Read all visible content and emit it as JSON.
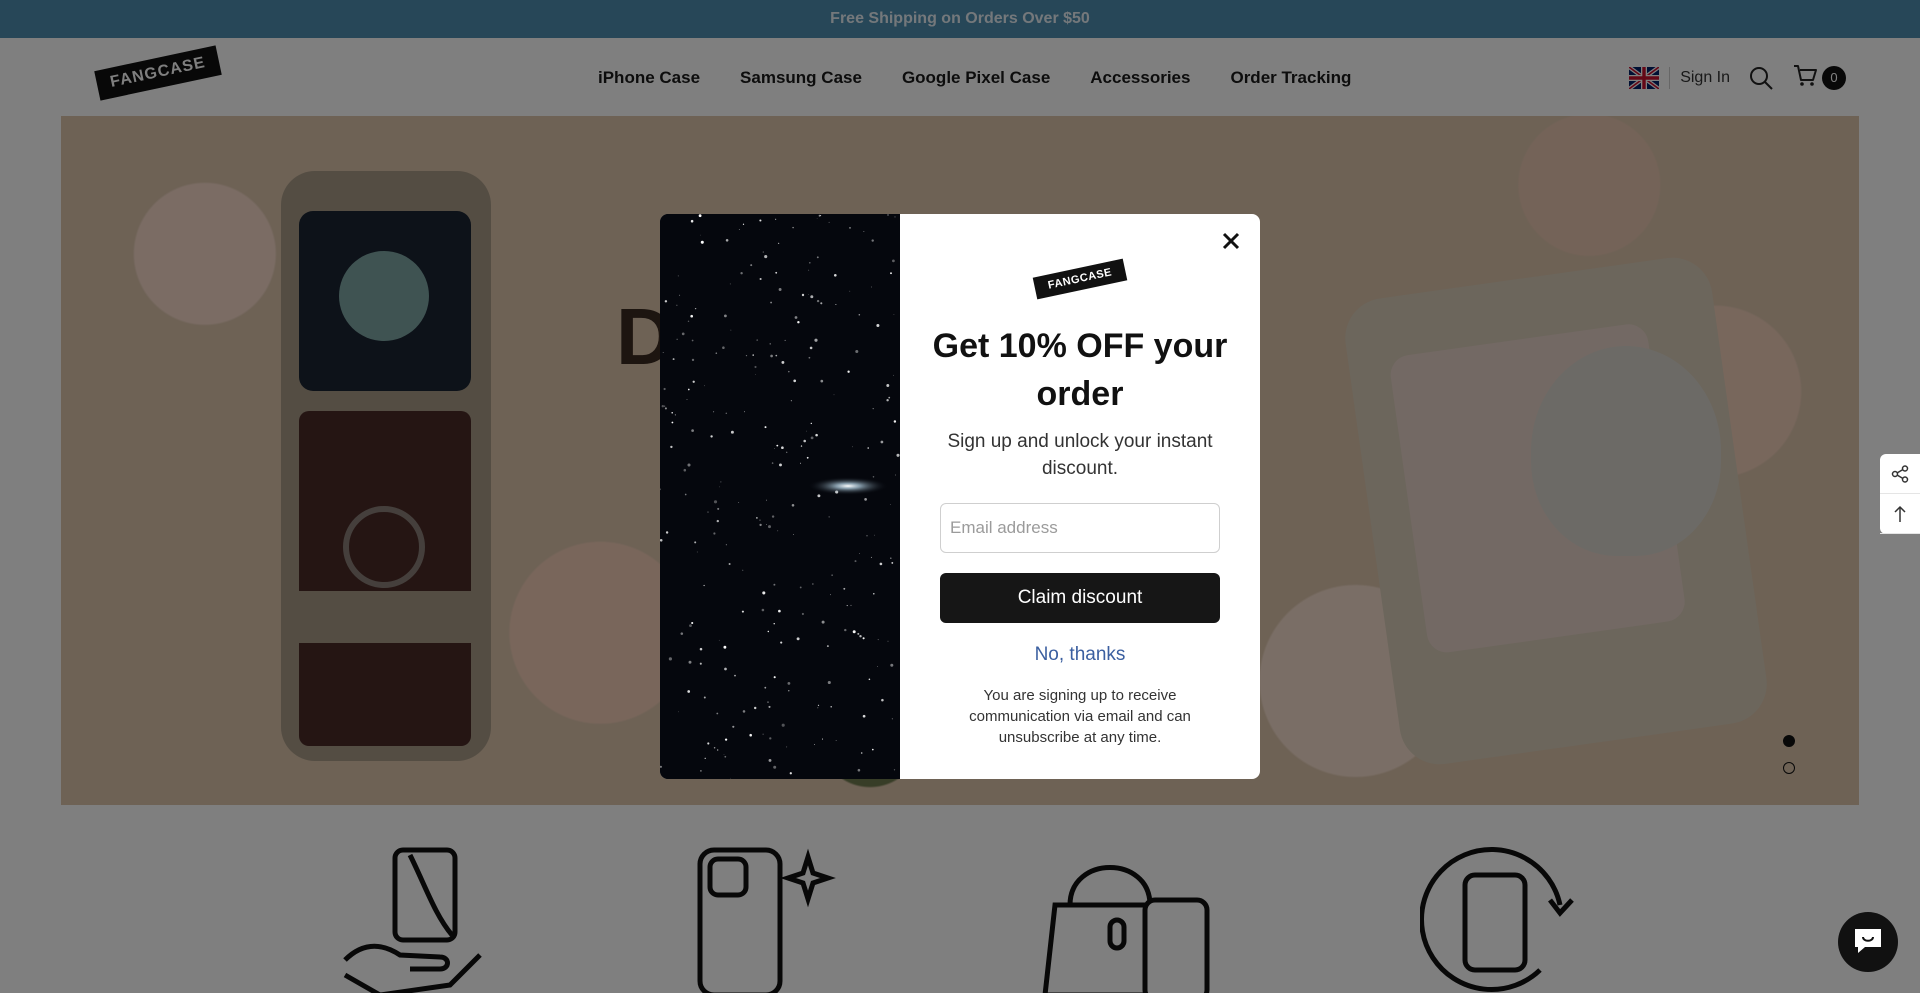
{
  "announcement": {
    "text": "Free Shipping on Orders Over $50"
  },
  "header": {
    "logo_text": "FANGCASE",
    "nav": [
      {
        "label": "iPhone Case"
      },
      {
        "label": "Samsung Case"
      },
      {
        "label": "Google Pixel Case"
      },
      {
        "label": "Accessories"
      },
      {
        "label": "Order Tracking"
      }
    ],
    "language_flag": "uk-flag-icon",
    "signin_label": "Sign In",
    "cart_count": "0"
  },
  "hero": {
    "title_partial": "D                    p",
    "slide_count": 2,
    "active_slide": 1
  },
  "modal": {
    "logo_text": "FANGCASE",
    "title": "Get 10% OFF your order",
    "subtitle": "Sign up and unlock your instant discount.",
    "email_placeholder": "Email address",
    "email_value": "",
    "claim_label": "Claim discount",
    "no_thanks_label": "No, thanks",
    "disclaimer": "You are signing up to receive communication via email and can unsubscribe at any time."
  },
  "features": [
    {
      "icon": "hand-holding-phone-icon"
    },
    {
      "icon": "phone-sparkle-icon"
    },
    {
      "icon": "bag-and-phone-icon"
    },
    {
      "icon": "phone-rotate-icon"
    }
  ],
  "colors": {
    "announcement_bg": "#4f8eb1",
    "button_bg": "#161616",
    "link": "#3b5fa0"
  }
}
